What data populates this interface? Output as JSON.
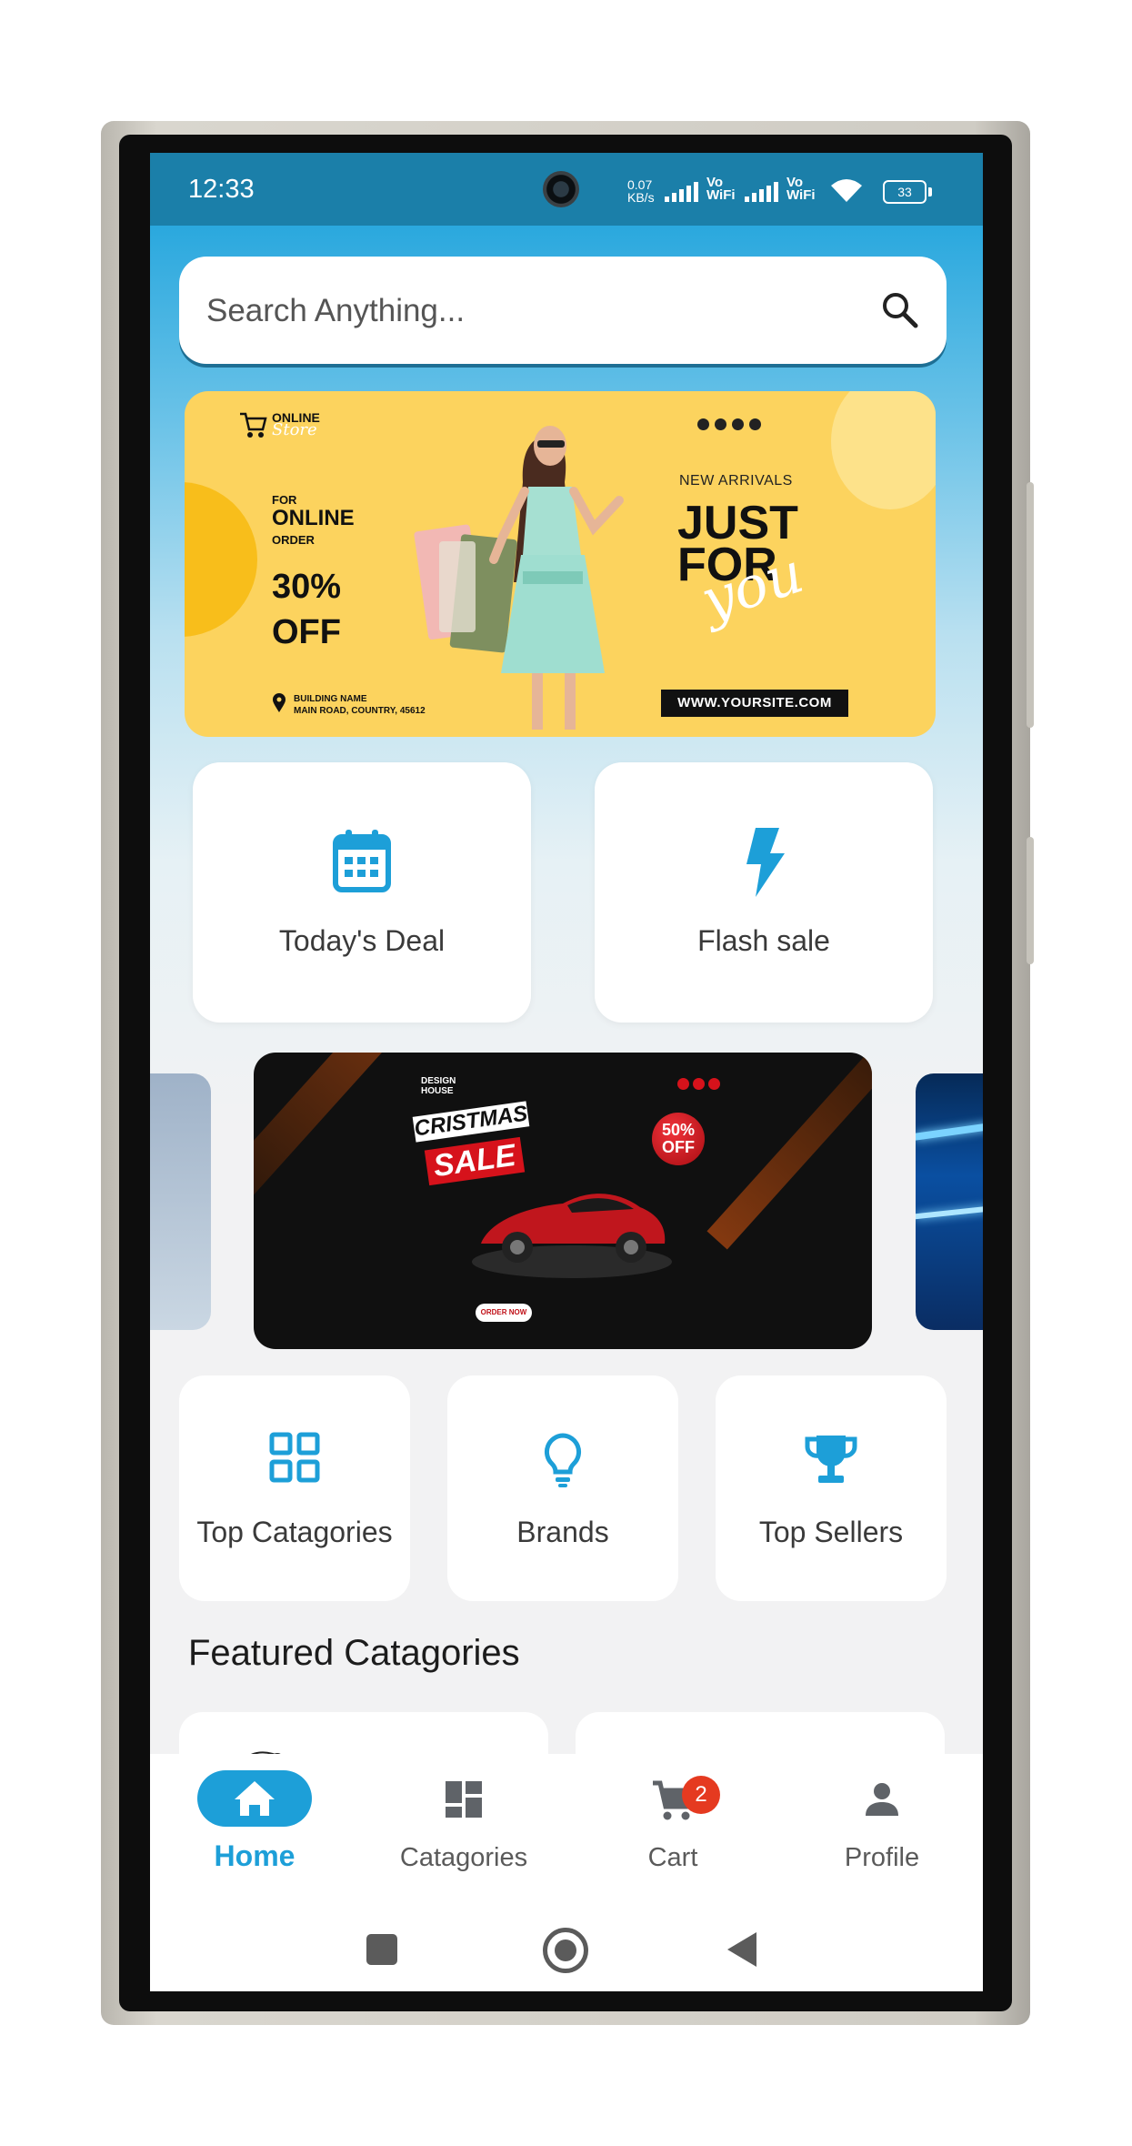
{
  "status_bar": {
    "time": "12:33",
    "net_speed_value": "0.07",
    "net_speed_unit": "KB/s",
    "vowifi_1": "Vo WiFi",
    "vowifi_2": "Vo WiFi",
    "battery": "33"
  },
  "search": {
    "placeholder": "Search Anything..."
  },
  "banner_top": {
    "store_brand": "ONLINE",
    "store_brand_script": "Store",
    "for_text": "FOR",
    "online_text": "ONLINE",
    "order_text": "ORDER",
    "discount_line1": "30%",
    "discount_line2": "OFF",
    "address_line1": "BUILDING NAME",
    "address_line2": "MAIN ROAD, COUNTRY, 45612",
    "new_arrivals": "NEW ARRIVALS",
    "headline_1": "JUST",
    "headline_2": "FOR",
    "headline_script": "you",
    "website": "WWW.YOURSITE.COM"
  },
  "quick_actions": [
    {
      "label": "Today's Deal",
      "icon": "calendar-icon"
    },
    {
      "label": "Flash sale",
      "icon": "flash-icon"
    }
  ],
  "banner_carousel": {
    "brand_line1": "DESIGN",
    "brand_line2": "HOUSE",
    "sale_line1": "CRISTMAS",
    "sale_line2": "SALE",
    "badge_line1": "50%",
    "badge_line2": "OFF",
    "order_button": "ORDER NOW"
  },
  "categories": [
    {
      "label": "Top Catagories",
      "icon": "grid-icon"
    },
    {
      "label": "Brands",
      "icon": "lightbulb-icon"
    },
    {
      "label": "Top Sellers",
      "icon": "trophy-icon"
    }
  ],
  "featured": {
    "title": "Featured Catagories"
  },
  "bottom_nav": {
    "items": [
      {
        "label": "Home",
        "icon": "home-icon",
        "active": true
      },
      {
        "label": "Catagories",
        "icon": "dashboard-icon",
        "active": false
      },
      {
        "label": "Cart",
        "icon": "cart-icon",
        "active": false,
        "badge": "2"
      },
      {
        "label": "Profile",
        "icon": "person-icon",
        "active": false
      }
    ]
  },
  "colors": {
    "accent": "#1d9fd8",
    "status_bar": "#1b7fa9",
    "badge": "#e53a20"
  }
}
